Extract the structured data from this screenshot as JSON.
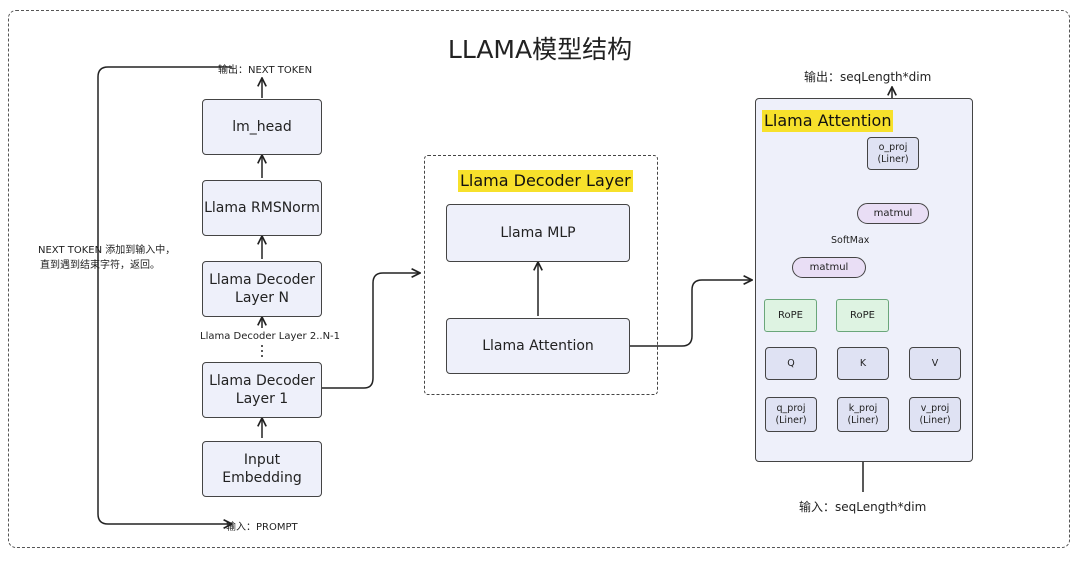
{
  "title": "LLAMA模型结构",
  "left": {
    "output_label": "输出：NEXT TOKEN",
    "input_label": "输入：PROMPT",
    "loop_note_line1": "NEXT TOKEN 添加到输入中，",
    "loop_note_line2": "直到遇到结束字符，返回。",
    "lm_head": "lm_head",
    "rmsnorm": "Llama RMSNorm",
    "decoder_n_line1": "Llama Decoder",
    "decoder_n_line2": "Layer N",
    "decoder_middle": "Llama Decoder Layer 2..N-1",
    "decoder_1_line1": "Llama Decoder",
    "decoder_1_line2": "Layer 1",
    "input_embedding": "Input Embedding"
  },
  "decoder_layer": {
    "title": "Llama Decoder Layer",
    "mlp": "Llama MLP",
    "attention": "Llama Attention"
  },
  "attention": {
    "title": "Llama Attention",
    "output_label": "输出：seqLength*dim",
    "input_label": "输入：seqLength*dim",
    "o_proj_line1": "o_proj",
    "o_proj_line2": "(Liner)",
    "matmul_top": "matmul",
    "softmax": "SoftMax",
    "matmul_bottom": "matmul",
    "rope_left": "RoPE",
    "rope_right": "RoPE",
    "q": "Q",
    "k": "K",
    "v": "V",
    "q_proj_line1": "q_proj",
    "q_proj_line2": "(Liner)",
    "k_proj_line1": "k_proj",
    "k_proj_line2": "(Liner)",
    "v_proj_line1": "v_proj",
    "v_proj_line2": "(Liner)"
  },
  "colors": {
    "highlight": "#f7e12b",
    "box_fill": "#eef0fa",
    "matmul_fill": "#e9def5",
    "rope_fill": "#def3e2",
    "rope_border": "#6aa67a"
  }
}
